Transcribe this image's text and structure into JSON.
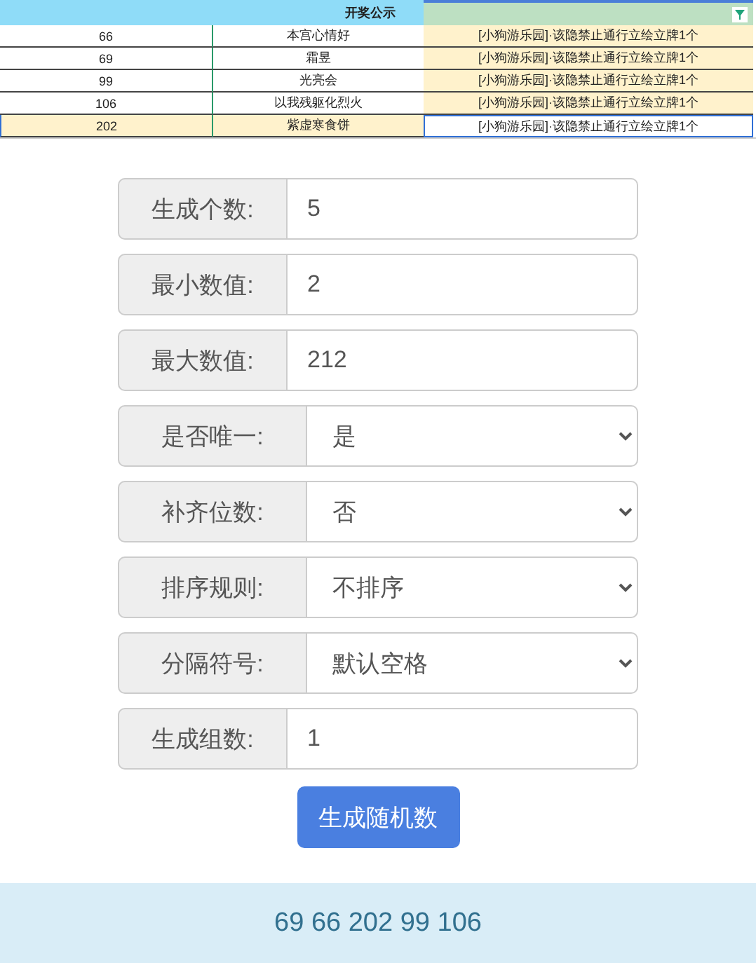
{
  "table": {
    "title": "开奖公示",
    "rows": [
      {
        "cells": [
          "66",
          "本宫心情好",
          "[小狗游乐园]·该隐禁止通行立绘立牌1个"
        ],
        "selected": false
      },
      {
        "cells": [
          "69",
          "霜昱",
          "[小狗游乐园]·该隐禁止通行立绘立牌1个"
        ],
        "selected": false
      },
      {
        "cells": [
          "99",
          "光亮会",
          "[小狗游乐园]·该隐禁止通行立绘立牌1个"
        ],
        "selected": false
      },
      {
        "cells": [
          "106",
          "以我残躯化烈火",
          "[小狗游乐园]·该隐禁止通行立绘立牌1个"
        ],
        "selected": false
      },
      {
        "cells": [
          "202",
          "紫虚寒食饼",
          "[小狗游乐园]·该隐禁止通行立绘立牌1个"
        ],
        "selected": true
      }
    ]
  },
  "form": {
    "fields": [
      {
        "label": "生成个数:",
        "kind": "input",
        "value": "5"
      },
      {
        "label": "最小数值:",
        "kind": "input",
        "value": "2"
      },
      {
        "label": "最大数值:",
        "kind": "input",
        "value": "212"
      },
      {
        "label": "是否唯一:",
        "kind": "select",
        "value": "是"
      },
      {
        "label": "补齐位数:",
        "kind": "select",
        "value": "否"
      },
      {
        "label": "排序规则:",
        "kind": "select",
        "value": "不排序"
      },
      {
        "label": "分隔符号:",
        "kind": "select",
        "value": "默认空格"
      },
      {
        "label": "生成组数:",
        "kind": "input",
        "value": "1"
      }
    ],
    "button": "生成随机数"
  },
  "result": "69 66 202 99 106"
}
